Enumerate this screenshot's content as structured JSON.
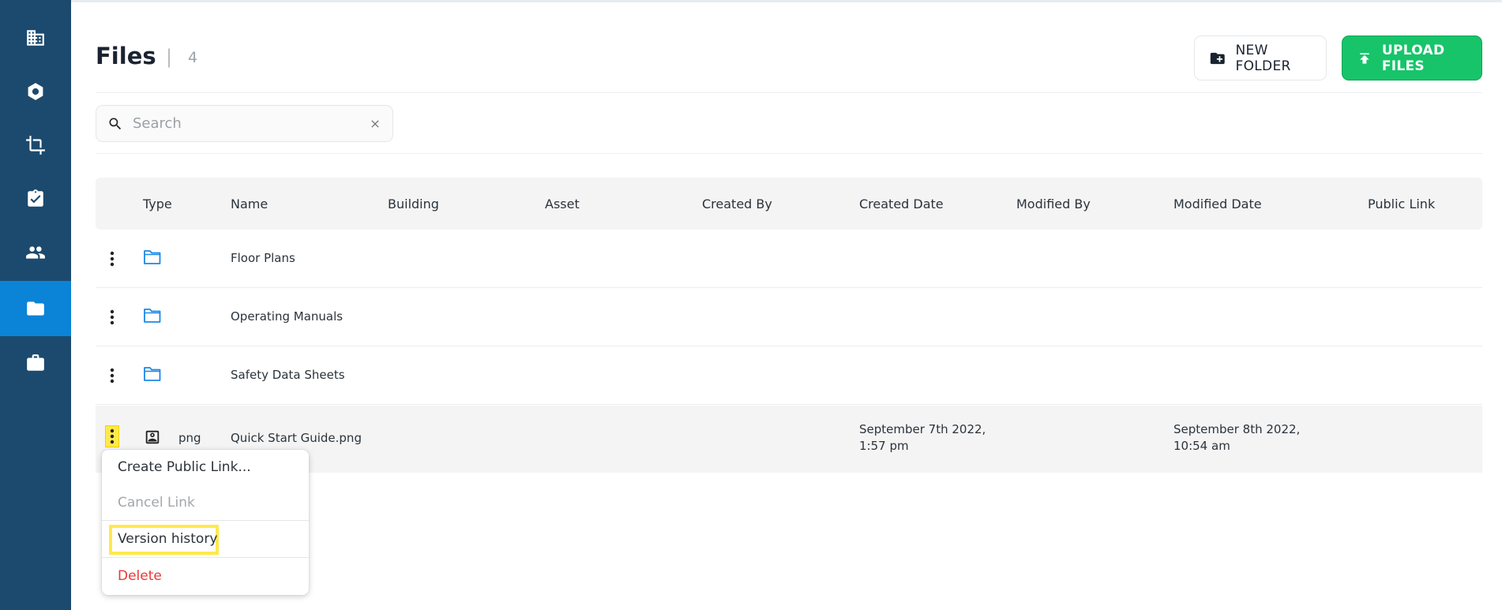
{
  "colors": {
    "sidebar": "#1c4a6e",
    "sidebar_active": "#0b84d8",
    "primary_green": "#17c46a",
    "folder_blue": "#1e88e5",
    "danger": "#e53935",
    "highlight": "#ffe94a"
  },
  "sidebar": {
    "items": [
      {
        "icon": "building-icon"
      },
      {
        "icon": "hexagon-icon"
      },
      {
        "icon": "crop-icon"
      },
      {
        "icon": "clipboard-check-icon"
      },
      {
        "icon": "people-icon"
      },
      {
        "icon": "folder-icon",
        "active": true
      },
      {
        "icon": "briefcase-icon"
      }
    ]
  },
  "header": {
    "title": "Files",
    "separator": "|",
    "count": "4",
    "new_folder_label": "NEW FOLDER",
    "upload_label": "UPLOAD FILES"
  },
  "search": {
    "placeholder": "Search"
  },
  "table": {
    "columns": [
      "Type",
      "Name",
      "Building",
      "Asset",
      "Created By",
      "Created Date",
      "Modified By",
      "Modified Date",
      "Public Link"
    ],
    "rows": [
      {
        "type_icon": "folder-icon",
        "type_label": "",
        "name": "Floor Plans",
        "created_date_1": "",
        "created_date_2": "",
        "modified_date_1": "",
        "modified_date_2": ""
      },
      {
        "type_icon": "folder-icon",
        "type_label": "",
        "name": "Operating Manuals",
        "created_date_1": "",
        "created_date_2": "",
        "modified_date_1": "",
        "modified_date_2": ""
      },
      {
        "type_icon": "folder-icon",
        "type_label": "",
        "name": "Safety Data Sheets",
        "created_date_1": "",
        "created_date_2": "",
        "modified_date_1": "",
        "modified_date_2": ""
      },
      {
        "type_icon": "image-file-icon",
        "type_label": "png",
        "name": "Quick Start Guide.png",
        "created_date_1": "September 7th 2022,",
        "created_date_2": "1:57 pm",
        "modified_date_1": "September 8th 2022,",
        "modified_date_2": "10:54 am"
      }
    ]
  },
  "context_menu": {
    "items": [
      "Create Public Link...",
      "Cancel Link",
      "Version history",
      "Delete"
    ]
  }
}
